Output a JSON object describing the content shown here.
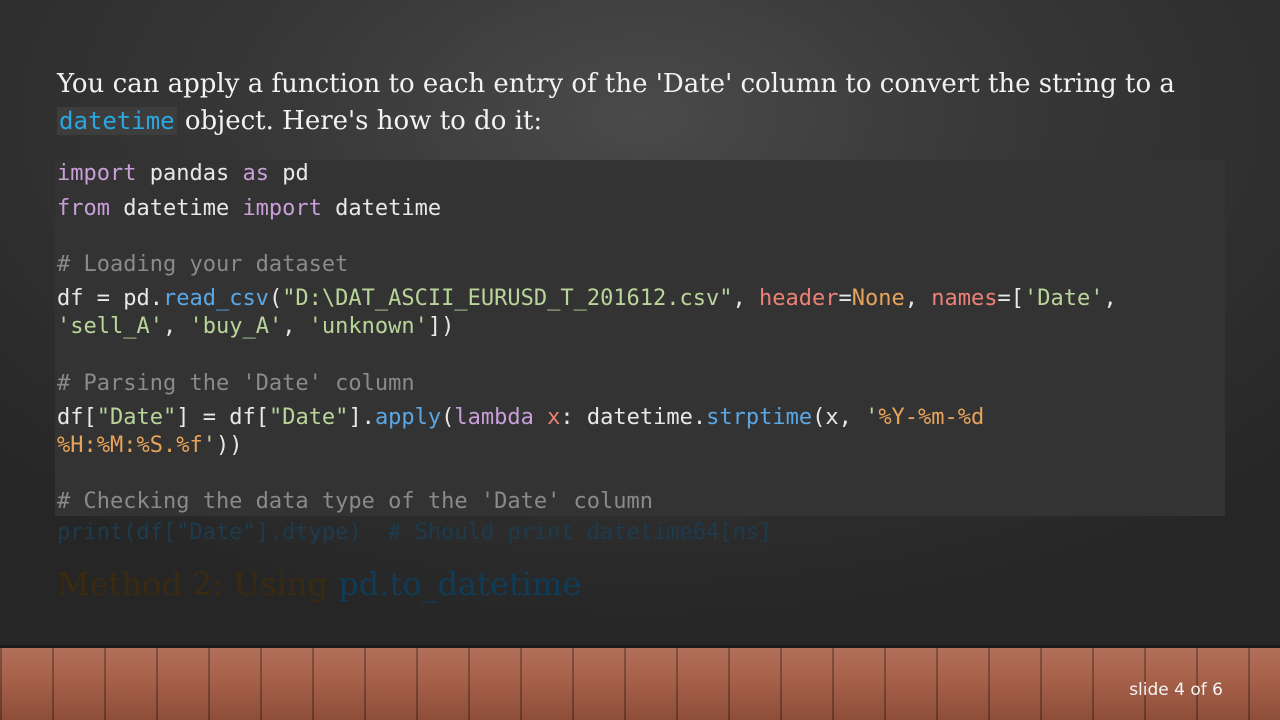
{
  "slide": {
    "intro_before": "You can apply a function to each entry of the 'Date' column to convert the string to a ",
    "intro_code": "datetime",
    "intro_after": " object. Here's how to do it:",
    "code_lines": [
      {
        "t": [
          {
            "c": "kw",
            "v": "import"
          },
          {
            "c": "",
            "v": " pandas "
          },
          {
            "c": "kw",
            "v": "as"
          },
          {
            "c": "",
            "v": " pd"
          }
        ]
      },
      {
        "t": [
          {
            "c": "kw",
            "v": "from"
          },
          {
            "c": "",
            "v": " datetime "
          },
          {
            "c": "kw",
            "v": "import"
          },
          {
            "c": "",
            "v": " datetime"
          }
        ]
      },
      {
        "t": [
          {
            "c": "cm",
            "v": "# Loading your dataset"
          }
        ]
      },
      {
        "t": [
          {
            "c": "",
            "v": "df = pd."
          },
          {
            "c": "fn",
            "v": "read_csv"
          },
          {
            "c": "",
            "v": "("
          },
          {
            "c": "st",
            "v": "\"D:\\DAT_ASCII_EURUSD_T_201612.csv\""
          },
          {
            "c": "",
            "v": ", "
          },
          {
            "c": "pm",
            "v": "header"
          },
          {
            "c": "",
            "v": "="
          },
          {
            "c": "cn",
            "v": "None"
          },
          {
            "c": "",
            "v": ", "
          },
          {
            "c": "pm",
            "v": "names"
          },
          {
            "c": "",
            "v": "=["
          },
          {
            "c": "st",
            "v": "'Date'"
          },
          {
            "c": "",
            "v": ","
          }
        ]
      },
      {
        "t": [
          {
            "c": "st",
            "v": "'sell_A'"
          },
          {
            "c": "",
            "v": ", "
          },
          {
            "c": "st",
            "v": "'buy_A'"
          },
          {
            "c": "",
            "v": ", "
          },
          {
            "c": "st",
            "v": "'unknown'"
          },
          {
            "c": "",
            "v": "])"
          }
        ]
      },
      {
        "t": [
          {
            "c": "cm",
            "v": "# Parsing the 'Date' column"
          }
        ]
      },
      {
        "t": [
          {
            "c": "",
            "v": "df["
          },
          {
            "c": "st",
            "v": "\"Date\""
          },
          {
            "c": "",
            "v": "] = df["
          },
          {
            "c": "st",
            "v": "\"Date\""
          },
          {
            "c": "",
            "v": "]."
          },
          {
            "c": "fn",
            "v": "apply"
          },
          {
            "c": "",
            "v": "("
          },
          {
            "c": "kw",
            "v": "lambda"
          },
          {
            "c": "",
            "v": " "
          },
          {
            "c": "pm",
            "v": "x"
          },
          {
            "c": "",
            "v": ": datetime."
          },
          {
            "c": "fn",
            "v": "strptime"
          },
          {
            "c": "",
            "v": "(x, "
          },
          {
            "c": "st",
            "v": "'"
          },
          {
            "c": "fmt",
            "v": "%Y-%m-%d"
          }
        ]
      },
      {
        "t": [
          {
            "c": "fmt",
            "v": "%H:%M:%S.%f"
          },
          {
            "c": "st",
            "v": "'"
          },
          {
            "c": "",
            "v": "))"
          }
        ]
      },
      {
        "t": [
          {
            "c": "cm",
            "v": "# Checking the data type of the 'Date' column"
          }
        ]
      }
    ],
    "overflow_code": "print(df[\"Date\"].dtype)  # Should print datetime64[ns]",
    "method_text": "Method 2: Using ",
    "method_code": "pd.to_datetime",
    "slide_number": "slide 4 of 6"
  }
}
